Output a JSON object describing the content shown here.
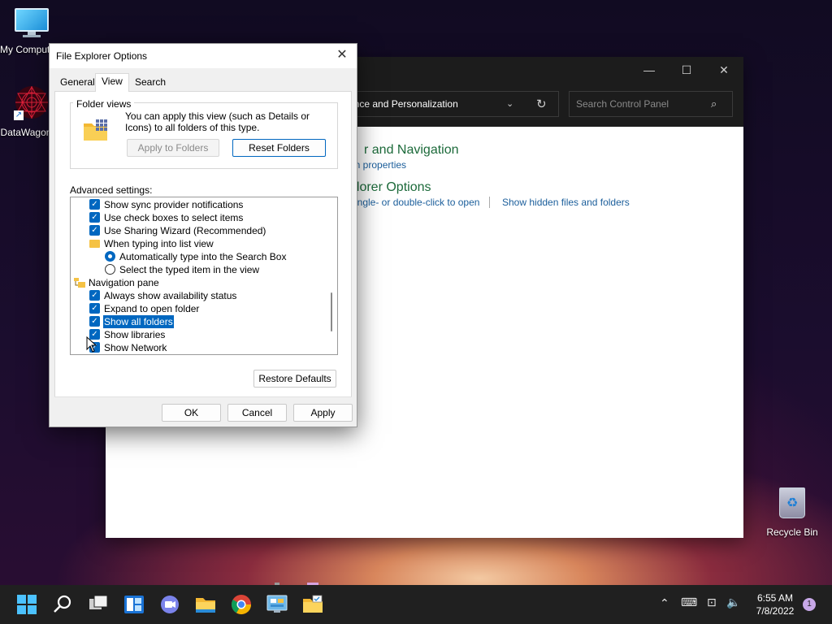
{
  "desktop": {
    "icons": [
      {
        "label": "My Computer"
      },
      {
        "label": "DataWagon"
      },
      {
        "label": "Recycle Bin"
      }
    ]
  },
  "control_panel": {
    "address": "rance and Personalization",
    "search_placeholder": "Search Control Panel",
    "heading1": "r and Navigation",
    "link1": "on properties",
    "heading2": "plorer Options",
    "link2": "ingle- or double-click to open",
    "link3": "Show hidden files and folders"
  },
  "dialog": {
    "title": "File Explorer Options",
    "tabs": [
      {
        "label": "General"
      },
      {
        "label": "View"
      },
      {
        "label": "Search"
      }
    ],
    "folder_views": {
      "title": "Folder views",
      "description": "You can apply this view (such as Details or Icons) to all folders of this type.",
      "apply_btn": "Apply to Folders",
      "reset_btn": "Reset Folders"
    },
    "advanced_label": "Advanced settings:",
    "advanced_items": [
      {
        "label": "Show sync provider notifications",
        "kind": "checkbox",
        "checked": true
      },
      {
        "label": "Use check boxes to select items",
        "kind": "checkbox",
        "checked": true
      },
      {
        "label": "Use Sharing Wizard (Recommended)",
        "kind": "checkbox",
        "checked": true
      },
      {
        "label": "When typing into list view",
        "kind": "folder"
      },
      {
        "label": "Automatically type into the Search Box",
        "kind": "radio",
        "checked": true
      },
      {
        "label": "Select the typed item in the view",
        "kind": "radio",
        "checked": false
      },
      {
        "label": "Navigation pane",
        "kind": "nav"
      },
      {
        "label": "Always show availability status",
        "kind": "checkbox",
        "checked": true
      },
      {
        "label": "Expand to open folder",
        "kind": "checkbox",
        "checked": true
      },
      {
        "label": "Show all folders",
        "kind": "checkbox",
        "checked": true,
        "selected": true
      },
      {
        "label": "Show libraries",
        "kind": "checkbox",
        "checked": true
      },
      {
        "label": "Show Network",
        "kind": "checkbox",
        "checked": true
      }
    ],
    "restore_btn": "Restore Defaults",
    "ok_btn": "OK",
    "cancel_btn": "Cancel",
    "apply_btn": "Apply"
  },
  "taskbar": {
    "icons": [
      "windows-start-icon",
      "search-icon",
      "task-view-icon",
      "widgets-icon",
      "teams-chat-icon",
      "file-explorer-icon",
      "chrome-icon",
      "control-panel-icon",
      "folder-options-icon"
    ],
    "time": "6:55 AM",
    "date": "7/8/2022",
    "notification_count": "1"
  },
  "colors": {
    "accent": "#0067c0",
    "taskbar": "#202020",
    "link": "#1b5e9b",
    "heading": "#1c6a3a"
  }
}
